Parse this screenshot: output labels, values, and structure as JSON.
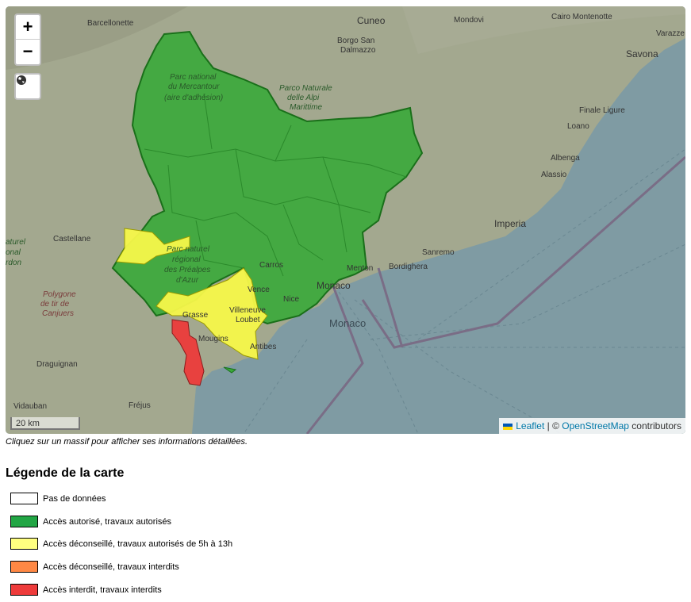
{
  "map": {
    "zoom_in_label": "+",
    "zoom_out_label": "−",
    "scale_label": "20 km",
    "attribution": {
      "leaflet": "Leaflet",
      "separator": " | © ",
      "osm": "OpenStreetMap",
      "suffix": " contributors"
    },
    "place_labels": {
      "barcellonette": "Barcellonette",
      "cuneo": "Cuneo",
      "mondovi": "Mondovi",
      "cairo_montenotte": "Cairo Montenotte",
      "varazze": "Varazze",
      "borgo_san_dalmazzo_1": "Borgo San",
      "borgo_san_dalmazzo_2": "Dalmazzo",
      "savona": "Savona",
      "parc_mercantour_1": "Parc national",
      "parc_mercantour_2": "du Mercantour",
      "parc_mercantour_3": "(aire d'adhésion)",
      "parco_alpi_1": "Parco Naturale",
      "parco_alpi_2": "delle Alpi",
      "parco_alpi_3": "Marittime",
      "finale_ligure": "Finale Ligure",
      "loano": "Loano",
      "albenga": "Albenga",
      "alassio": "Alassio",
      "imperia": "Imperia",
      "castellane": "Castellane",
      "parc_prealpes_1": "Parc naturel",
      "parc_prealpes_2": "régional",
      "parc_prealpes_3": "des Préalpes",
      "parc_prealpes_4": "d'Azur",
      "carros": "Carros",
      "sanremo": "Sanremo",
      "menton": "Menton",
      "bordighera": "Bordighera",
      "monaco_city": "Monaco",
      "monaco_sea": "Monaco",
      "polygone_1": "Polygone",
      "polygone_2": "de tir de",
      "polygone_3": "Canjuers",
      "vence": "Vence",
      "villeneuve": "Villeneuve",
      "loubet": "Loubet",
      "nice": "Nice",
      "grasse": "Grasse",
      "mougins": "Mougins",
      "antibes": "Antibes",
      "draguignan": "Draguignan",
      "vidauban": "Vidauban",
      "frejus": "Fréjus",
      "naturel_edge": "aturel",
      "regional_edge": "onal",
      "verdon_edge": "rdon"
    }
  },
  "note": "Cliquez sur un massif pour afficher ses informations détaillées.",
  "legend": {
    "title": "Légende de la carte",
    "items": [
      {
        "label": "Pas de données",
        "color": "#ffffff"
      },
      {
        "label": "Accès autorisé, travaux autorisés",
        "color": "#22a645"
      },
      {
        "label": "Accès déconseillé, travaux autorisés de 5h à 13h",
        "color": "#ffff80"
      },
      {
        "label": "Accès déconseillé, travaux interdits",
        "color": "#ff8844"
      },
      {
        "label": "Accès interdit, travaux interdits",
        "color": "#ee3b3b"
      }
    ]
  },
  "colors": {
    "green_zone": "#3aa83a",
    "yellow_zone": "#f7f74a",
    "red_zone": "#e8413f",
    "sea": "#7f9ba3",
    "land": "#9fa48f",
    "link": "#0078a8"
  }
}
